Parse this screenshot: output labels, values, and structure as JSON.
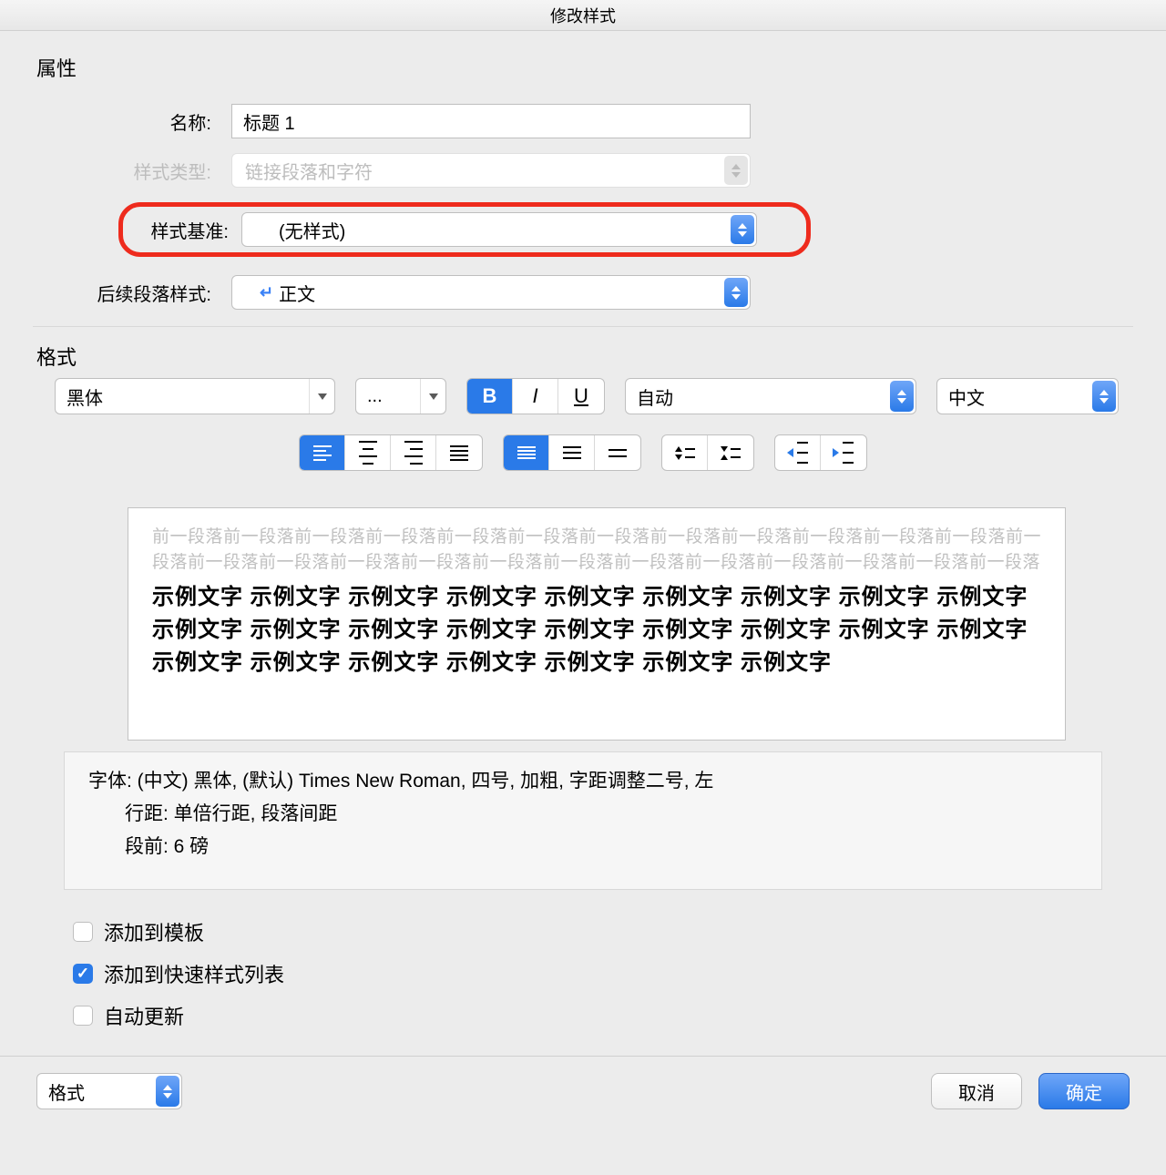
{
  "title": "修改样式",
  "sections": {
    "attributes": "属性",
    "format": "格式"
  },
  "labels": {
    "name": "名称:",
    "styleType": "样式类型:",
    "styleBasedOn": "样式基准:",
    "nextParaStyle": "后续段落样式:"
  },
  "fields": {
    "name": "标题 1",
    "styleType": "链接段落和字符",
    "styleBasedOn": "(无样式)",
    "nextParaStyle": "正文"
  },
  "format": {
    "font": "黑体",
    "size": "...",
    "B": "B",
    "I": "I",
    "U": "U",
    "color": "自动",
    "lang": "中文"
  },
  "preview": {
    "prev": "前一段落前一段落前一段落前一段落前一段落前一段落前一段落前一段落前一段落前一段落前一段落前一段落前一段落前一段落前一段落前一段落前一段落前一段落前一段落前一段落前一段落前一段落前一段落前一段落前一段落",
    "sample": "示例文字   示例文字   示例文字   示例文字   示例文字   示例文字   示例文字   示例文字   示例文字   示例文字   示例文字   示例文字   示例文字   示例文字   示例文字   示例文字   示例文字   示例文字   示例文字   示例文字   示例文字   示例文字   示例文字   示例文字   示例文字"
  },
  "description": {
    "line1": "字体: (中文) 黑体, (默认) Times New Roman, 四号, 加粗, 字距调整二号, 左",
    "line2": "行距: 单倍行距, 段落间距",
    "line3": "段前: 6 磅"
  },
  "checks": {
    "addToTemplate": {
      "label": "添加到模板",
      "checked": false
    },
    "addToQuick": {
      "label": "添加到快速样式列表",
      "checked": true
    },
    "autoUpdate": {
      "label": "自动更新",
      "checked": false
    }
  },
  "footer": {
    "formatMenu": "格式",
    "cancel": "取消",
    "ok": "确定"
  }
}
